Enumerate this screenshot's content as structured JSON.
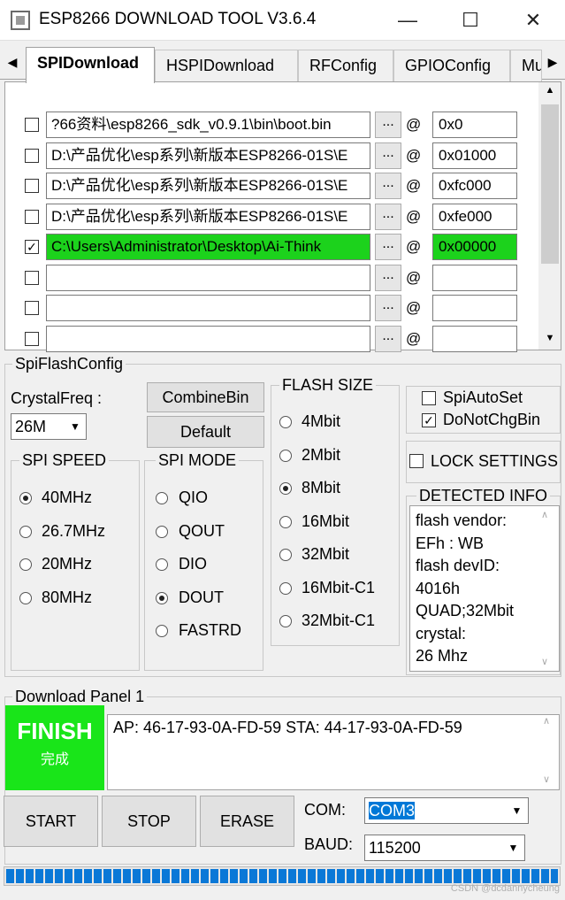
{
  "window": {
    "title": "ESP8266 DOWNLOAD TOOL V3.6.4",
    "minimize_glyph": "—",
    "maximize_glyph": "☐",
    "close_glyph": "✕",
    "icon": "app-icon"
  },
  "tabs": [
    {
      "label": "SPIDownload",
      "active": true
    },
    {
      "label": "HSPIDownload",
      "active": false
    },
    {
      "label": "RFConfig",
      "active": false
    },
    {
      "label": "GPIOConfig",
      "active": false
    },
    {
      "label": "Mu",
      "active": false
    }
  ],
  "tab_scroll": {
    "left": "◀",
    "right": "▶"
  },
  "files": [
    {
      "checked": false,
      "path": "?66资料\\esp8266_sdk_v0.9.1\\bin\\boot.bin",
      "browse": "...",
      "at": "@",
      "addr": "0x0",
      "highlight": false
    },
    {
      "checked": false,
      "path": "D:\\产品优化\\esp系列\\新版本ESP8266-01S\\E",
      "browse": "...",
      "at": "@",
      "addr": "0x01000",
      "highlight": false
    },
    {
      "checked": false,
      "path": "D:\\产品优化\\esp系列\\新版本ESP8266-01S\\E",
      "browse": "...",
      "at": "@",
      "addr": "0xfc000",
      "highlight": false
    },
    {
      "checked": false,
      "path": "D:\\产品优化\\esp系列\\新版本ESP8266-01S\\E",
      "browse": "...",
      "at": "@",
      "addr": "0xfe000",
      "highlight": false
    },
    {
      "checked": true,
      "path": "C:\\Users\\Administrator\\Desktop\\Ai-Think",
      "browse": "...",
      "at": "@",
      "addr": "0x00000",
      "highlight": true
    },
    {
      "checked": false,
      "path": "",
      "browse": "...",
      "at": "@",
      "addr": "",
      "highlight": false
    },
    {
      "checked": false,
      "path": "",
      "browse": "...",
      "at": "@",
      "addr": "",
      "highlight": false
    },
    {
      "checked": false,
      "path": "",
      "browse": "...",
      "at": "@",
      "addr": "",
      "highlight": false
    }
  ],
  "spi_flash_config": {
    "title": "SpiFlashConfig",
    "crystal_label": "CrystalFreq :",
    "crystal_value": "26M",
    "combine_bin": "CombineBin",
    "default_btn": "Default",
    "spi_speed": {
      "title": "SPI SPEED",
      "options": [
        {
          "label": "40MHz",
          "selected": true
        },
        {
          "label": "26.7MHz",
          "selected": false
        },
        {
          "label": "20MHz",
          "selected": false
        },
        {
          "label": "80MHz",
          "selected": false
        }
      ]
    },
    "spi_mode": {
      "title": "SPI MODE",
      "options": [
        {
          "label": "QIO",
          "selected": false
        },
        {
          "label": "QOUT",
          "selected": false
        },
        {
          "label": "DIO",
          "selected": false
        },
        {
          "label": "DOUT",
          "selected": true
        },
        {
          "label": "FASTRD",
          "selected": false
        }
      ]
    },
    "flash_size": {
      "title": "FLASH SIZE",
      "options": [
        {
          "label": "4Mbit",
          "selected": false
        },
        {
          "label": "2Mbit",
          "selected": false
        },
        {
          "label": "8Mbit",
          "selected": true
        },
        {
          "label": "16Mbit",
          "selected": false
        },
        {
          "label": "32Mbit",
          "selected": false
        },
        {
          "label": "16Mbit-C1",
          "selected": false
        },
        {
          "label": "32Mbit-C1",
          "selected": false
        }
      ]
    },
    "spi_auto_set": {
      "label": "SpiAutoSet",
      "checked": false
    },
    "do_not_chg_bin": {
      "label": "DoNotChgBin",
      "checked": true
    },
    "lock_settings": {
      "label": "LOCK SETTINGS",
      "checked": false
    },
    "detected_info": {
      "title": "DETECTED INFO",
      "lines": [
        "flash vendor:",
        "EFh : WB",
        "flash devID:",
        "4016h",
        "QUAD;32Mbit",
        "crystal:",
        "26 Mhz"
      ]
    }
  },
  "download_panel": {
    "title": "Download Panel 1",
    "status_en": "FINISH",
    "status_cn": "完成",
    "status_color": "#19e519",
    "log": "AP:  46-17-93-0A-FD-59  STA:  44-17-93-0A-FD-59",
    "start": "START",
    "stop": "STOP",
    "erase": "ERASE",
    "com_label": "COM:",
    "com_value": "COM3",
    "baud_label": "BAUD:",
    "baud_value": "115200",
    "progress": 1.0
  },
  "watermark": "CSDN @dcdannycheung"
}
